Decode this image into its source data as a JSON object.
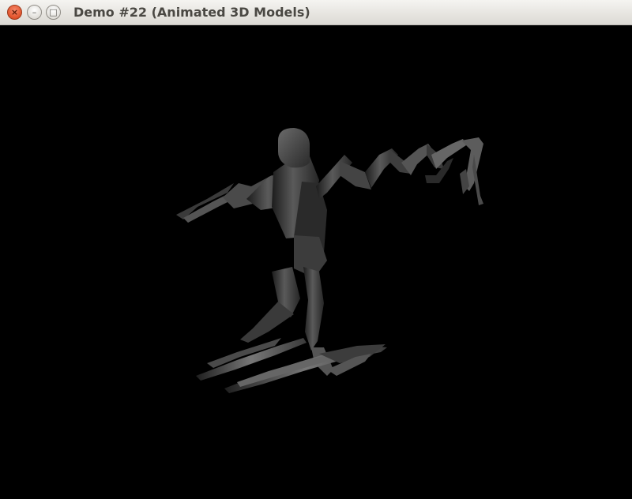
{
  "window": {
    "title": "Demo #22 (Animated 3D Models)",
    "controls": {
      "close_glyph": "×",
      "minimize_glyph": "–",
      "maximize_glyph": "□"
    },
    "icons": [
      "close-icon",
      "minimize-icon",
      "maximize-icon"
    ]
  },
  "viewport": {
    "background_color": "#000000",
    "model_color": "#4a4a4a"
  }
}
